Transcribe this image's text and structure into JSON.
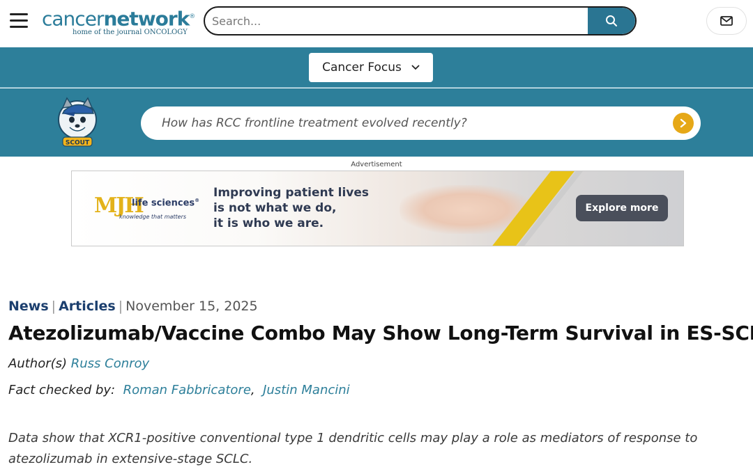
{
  "header": {
    "logo_main_light": "cancer",
    "logo_main_bold": "network",
    "logo_registered": "®",
    "logo_sub": "home of the journal ONCOLOGY",
    "search_placeholder": "Search..."
  },
  "focus": {
    "label": "Cancer Focus"
  },
  "scout": {
    "badge_text": "SCOUT",
    "ask_placeholder": "How has RCC frontline treatment evolved recently?"
  },
  "ad": {
    "label": "Advertisement",
    "logo_text": "MJH",
    "brand": "life sciences",
    "brand_registered": "®",
    "brand_tagline": "knowledge that matters",
    "headline": "Improving patient lives\nis not what we do,\nit is who we are.",
    "cta": "Explore more",
    "colors": {
      "stripe": "#e8c318",
      "cta_bg": "#4a4f5b",
      "headline": "#2f3a52"
    }
  },
  "article": {
    "breadcrumbs": [
      "News",
      "Articles"
    ],
    "separator": "|",
    "date": "November 15, 2025",
    "title": "Atezolizumab/Vaccine Combo May Show Long-Term Survival in ES-SCLC",
    "author_label": "Author(s)",
    "author": "Russ Conroy",
    "fact_checked_label": "Fact checked by:",
    "fact_checkers": [
      "Roman Fabbricatore",
      "Justin Mancini"
    ],
    "fact_checker_separator": ",",
    "summary": "Data show that XCR1-positive conventional type 1 dendritic cells may play a role as mediators of response to atezolizumab in extensive-stage SCLC."
  },
  "colors": {
    "teal_band": "#2d7f9a",
    "search_button": "#2a7592",
    "ask_button": "#e6a817",
    "breadcrumb_link": "#1c3f6e",
    "person_link": "#2d7f9a"
  },
  "icons": {
    "menu": "hamburger-icon",
    "search": "search-icon",
    "mail": "mail-icon",
    "chevron": "chevron-down-icon",
    "ask_arrow": "arrow-right-icon",
    "mascot": "scout-mascot-icon"
  }
}
